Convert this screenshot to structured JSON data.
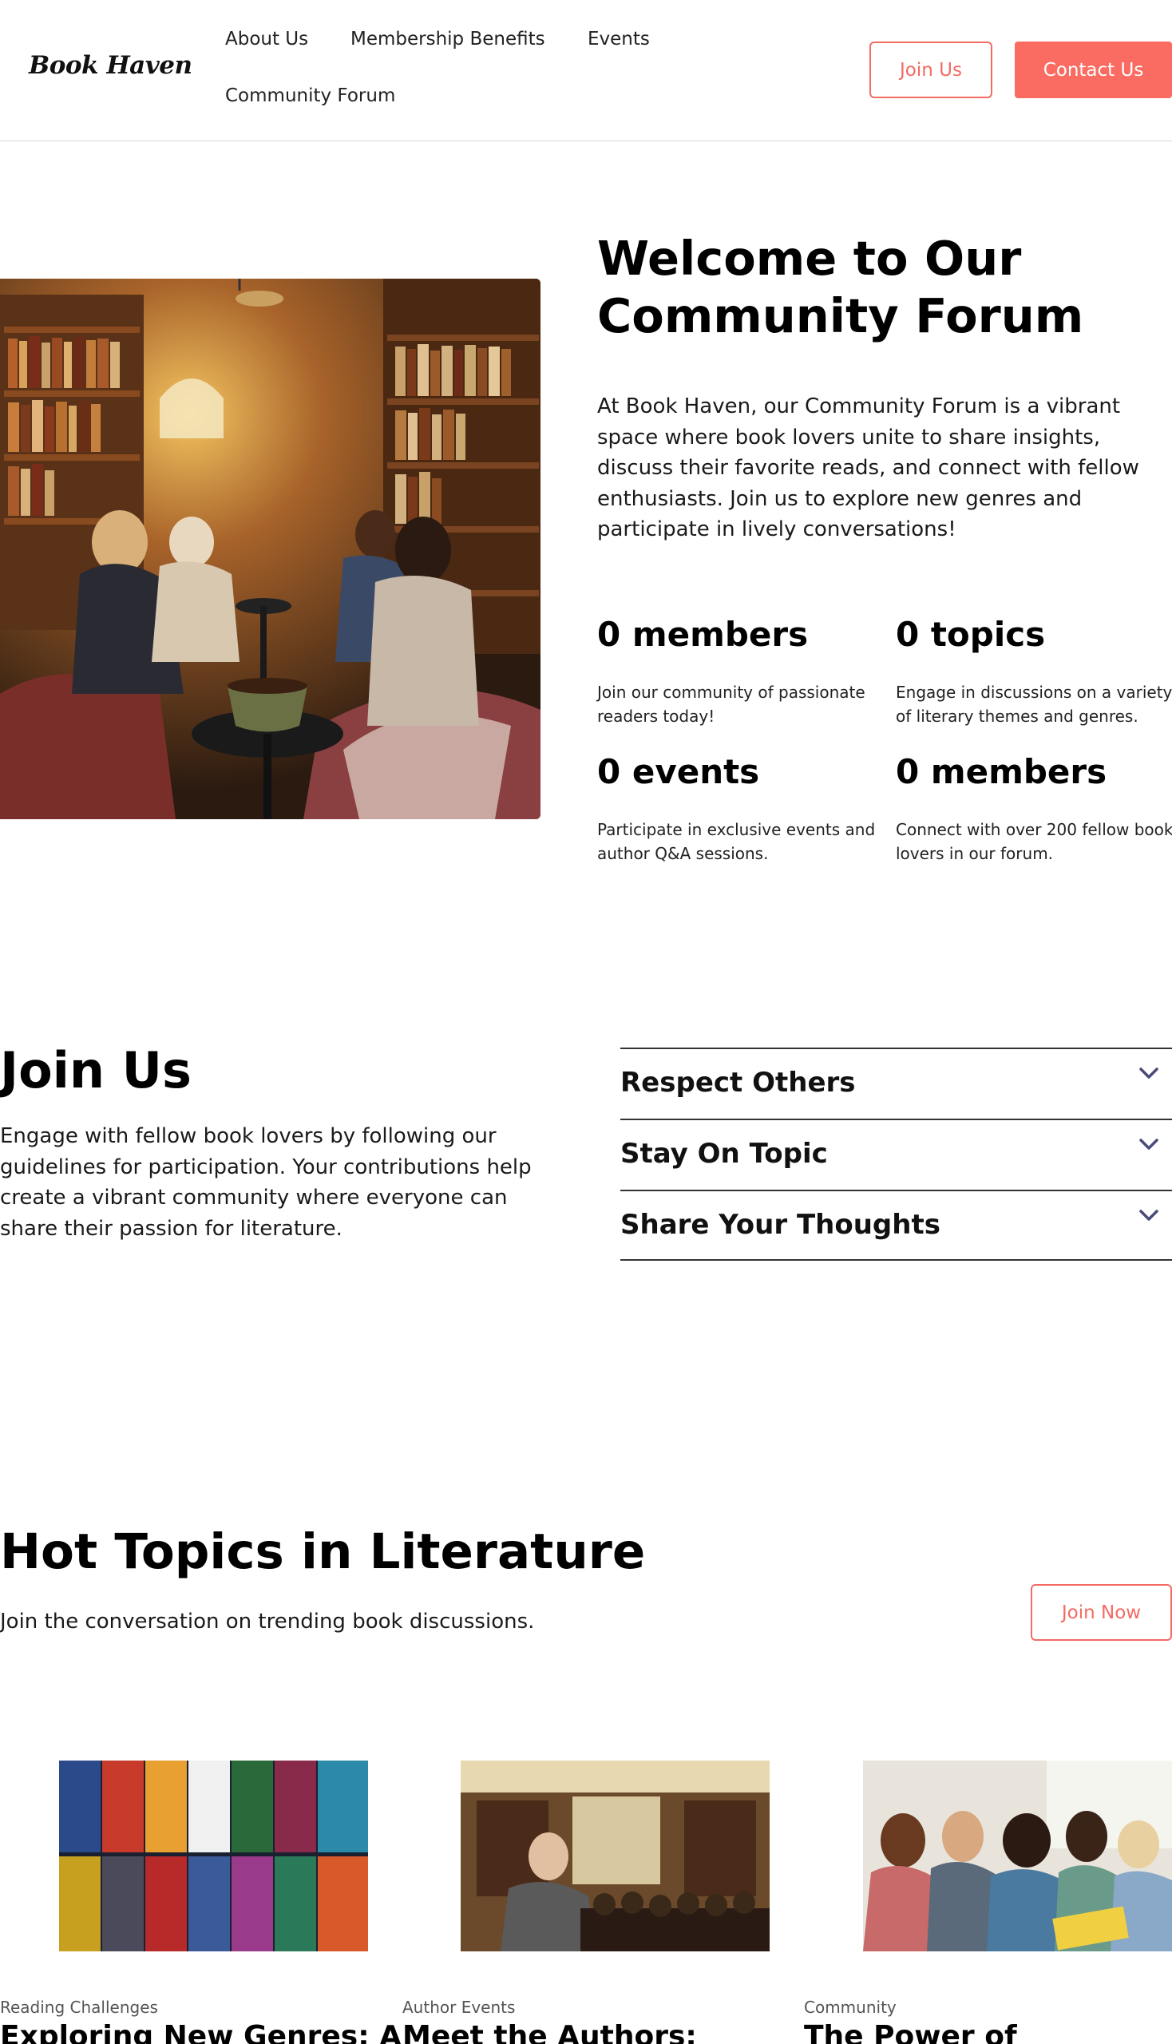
{
  "header": {
    "logo": "Book Haven",
    "nav": [
      "About Us",
      "Membership Benefits",
      "Events",
      "Community Forum"
    ],
    "join_btn": "Join Us",
    "contact_btn": "Contact Us"
  },
  "hero": {
    "title": "Welcome to Our Community Forum",
    "text": "At Book Haven, our Community Forum is a vibrant space where book lovers unite to share insights, discuss their favorite reads, and connect with fellow enthusiasts. Join us to explore new genres and participate in lively conversations!",
    "stats": [
      {
        "value": "0 members",
        "desc": "Join our community of passionate readers today!"
      },
      {
        "value": "0 topics",
        "desc": "Engage in discussions on a variety of literary themes and genres."
      },
      {
        "value": "0 events",
        "desc": "Participate in exclusive events and author Q&A sessions."
      },
      {
        "value": "0 members",
        "desc": "Connect with over 200 fellow book lovers in our forum."
      }
    ]
  },
  "join": {
    "title": "Join Us",
    "text": "Engage with fellow book lovers by following our guidelines for participation. Your contributions help create a vibrant community where everyone can share their passion for literature.",
    "accordion": [
      "Respect Others",
      "Stay On Topic",
      "Share Your Thoughts"
    ]
  },
  "topics": {
    "title": "Hot Topics in Literature",
    "subtitle": "Join the conversation on trending book discussions.",
    "join_btn": "Join Now",
    "cards": [
      {
        "category": "Reading Challenges",
        "title": "Exploring New Genres: A"
      },
      {
        "category": "Author Events",
        "title": "Meet the Authors:"
      },
      {
        "category": "Community",
        "title": "The Power of"
      }
    ]
  },
  "colors": {
    "accent": "#fa6c62",
    "accent_outline": "#f36b63",
    "chevron": "#4a4a7a"
  }
}
